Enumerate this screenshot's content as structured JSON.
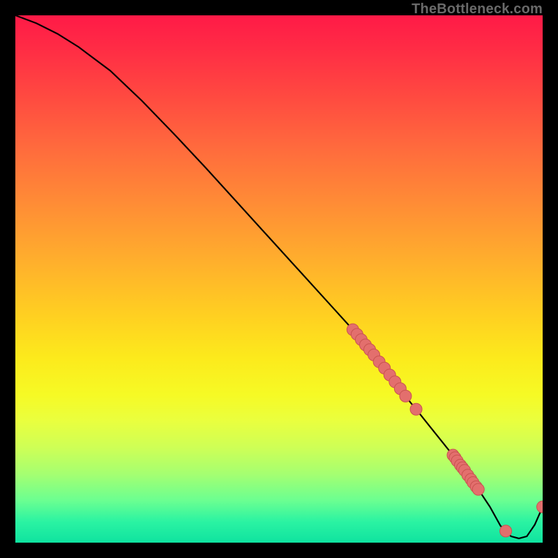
{
  "watermark": {
    "text": "TheBottleneck.com"
  },
  "chart_data": {
    "type": "line",
    "title": "",
    "xlabel": "",
    "ylabel": "",
    "x": [
      0,
      4,
      8,
      12,
      18,
      24,
      30,
      36,
      42,
      48,
      54,
      60,
      64,
      68,
      72,
      73,
      74,
      75,
      76,
      78,
      80,
      82,
      84,
      86,
      88,
      90,
      92,
      94,
      95.5,
      97,
      98.5,
      100
    ],
    "y": [
      100,
      98.5,
      96.5,
      94,
      89.5,
      83.8,
      77.6,
      71.2,
      64.6,
      58,
      51.4,
      44.8,
      40.4,
      35.6,
      30.5,
      29.2,
      27.8,
      26.5,
      25.3,
      22.8,
      20.3,
      17.8,
      15.3,
      12.6,
      9.8,
      6.8,
      3.2,
      1.2,
      0.8,
      1.2,
      3.4,
      6.8
    ],
    "xlim": [
      0,
      100
    ],
    "ylim": [
      0,
      100
    ],
    "markers": [
      {
        "x": 64.0,
        "y": 40.4
      },
      {
        "x": 64.8,
        "y": 39.5
      },
      {
        "x": 65.6,
        "y": 38.5
      },
      {
        "x": 66.4,
        "y": 37.5
      },
      {
        "x": 67.2,
        "y": 36.6
      },
      {
        "x": 68.0,
        "y": 35.6
      },
      {
        "x": 69.0,
        "y": 34.3
      },
      {
        "x": 70.0,
        "y": 33.1
      },
      {
        "x": 71.0,
        "y": 31.8
      },
      {
        "x": 72.0,
        "y": 30.5
      },
      {
        "x": 73.0,
        "y": 29.2
      },
      {
        "x": 74.0,
        "y": 27.8
      },
      {
        "x": 76.0,
        "y": 25.3
      },
      {
        "x": 83.0,
        "y": 16.6
      },
      {
        "x": 83.4,
        "y": 16.1
      },
      {
        "x": 83.8,
        "y": 15.5
      },
      {
        "x": 84.4,
        "y": 14.7
      },
      {
        "x": 84.8,
        "y": 14.2
      },
      {
        "x": 85.2,
        "y": 13.7
      },
      {
        "x": 85.8,
        "y": 12.8
      },
      {
        "x": 86.4,
        "y": 12.0
      },
      {
        "x": 86.8,
        "y": 11.4
      },
      {
        "x": 87.4,
        "y": 10.6
      },
      {
        "x": 87.8,
        "y": 10.1
      },
      {
        "x": 93.0,
        "y": 2.2
      },
      {
        "x": 100.0,
        "y": 6.8
      }
    ],
    "colors": {
      "line": "#000000",
      "marker_fill": "#e36f6d",
      "marker_stroke": "#c95350"
    }
  }
}
